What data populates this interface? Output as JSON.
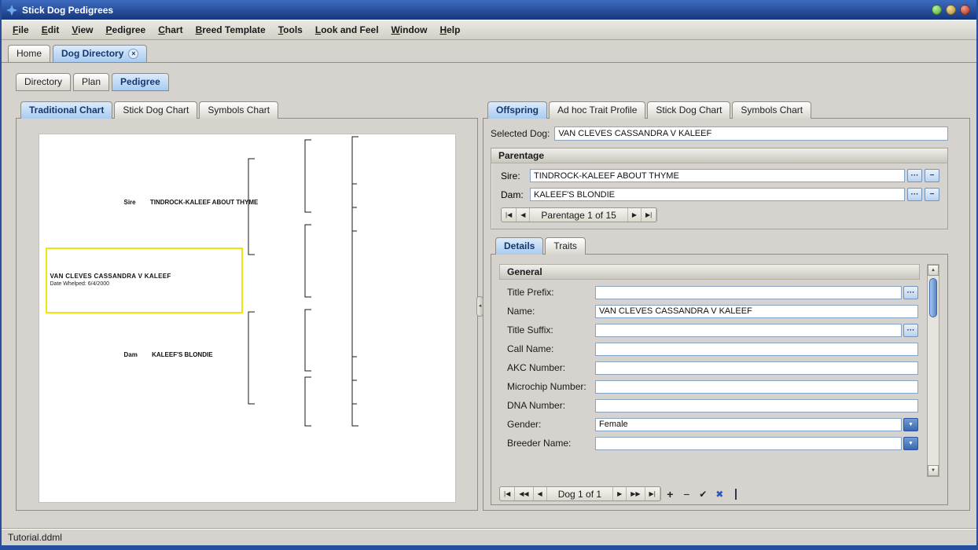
{
  "window": {
    "title": "Stick Dog Pedigrees"
  },
  "menu": {
    "items": [
      "File",
      "Edit",
      "View",
      "Pedigree",
      "Chart",
      "Breed Template",
      "Tools",
      "Look and Feel",
      "Window",
      "Help"
    ]
  },
  "document_tabs": {
    "home": "Home",
    "dog_directory": "Dog Directory"
  },
  "view_tabs": {
    "directory": "Directory",
    "plan": "Plan",
    "pedigree": "Pedigree"
  },
  "chart_panel": {
    "tabs": {
      "traditional": "Traditional Chart",
      "stick": "Stick Dog Chart",
      "symbols": "Symbols Chart"
    },
    "sire_label": "Sire",
    "sire_name": "TINDROCK-KALEEF ABOUT THYME",
    "subject_name": "VAN CLEVES CASSANDRA V KALEEF",
    "subject_whelped": "Date Whelped: 6/4/2000",
    "dam_label": "Dam",
    "dam_name": "KALEEF'S BLONDIE"
  },
  "offspring_panel": {
    "tabs": {
      "offspring": "Offspring",
      "adhoc": "Ad hoc Trait Profile",
      "stick": "Stick Dog Chart",
      "symbols": "Symbols Chart"
    },
    "selected_dog_label": "Selected Dog:",
    "selected_dog_value": "VAN CLEVES CASSANDRA V KALEEF",
    "parentage": {
      "title": "Parentage",
      "sire_label": "Sire:",
      "sire_value": "TINDROCK-KALEEF ABOUT THYME",
      "dam_label": "Dam:",
      "dam_value": "KALEEF'S BLONDIE",
      "nav_label": "Parentage 1 of 15"
    },
    "detail_tabs": {
      "details": "Details",
      "traits": "Traits"
    },
    "general": {
      "title": "General",
      "fields": [
        {
          "label": "Title Prefix:",
          "value": "",
          "control": "ellipsis"
        },
        {
          "label": "Name:",
          "value": "VAN CLEVES CASSANDRA V KALEEF",
          "control": "text"
        },
        {
          "label": "Title Suffix:",
          "value": "",
          "control": "ellipsis"
        },
        {
          "label": "Call Name:",
          "value": "",
          "control": "text"
        },
        {
          "label": "AKC Number:",
          "value": "",
          "control": "text"
        },
        {
          "label": "Microchip Number:",
          "value": "",
          "control": "text"
        },
        {
          "label": "DNA Number:",
          "value": "",
          "control": "text"
        },
        {
          "label": "Gender:",
          "value": "Female",
          "control": "dropdown"
        },
        {
          "label": "Breeder Name:",
          "value": "",
          "control": "dropdown"
        }
      ]
    },
    "record_nav_label": "Dog 1 of 1"
  },
  "status_bar": {
    "text": "Tutorial.ddml"
  },
  "icons": {
    "close_tab": "×",
    "ellipsis": "···",
    "remove": "−",
    "dropdown_arrow": "▼",
    "nav_first": "|◀",
    "nav_prev": "◀",
    "nav_next": "▶",
    "nav_last": "▶|",
    "nav_rewind": "◀◀",
    "nav_forward": "▶▶",
    "add": "+",
    "subtract": "−",
    "commit": "✔",
    "cancel": "✖",
    "scroll_up": "▲",
    "scroll_down": "▼",
    "splitter": "◂"
  },
  "colors": {
    "titlebar_blue": "#24509e",
    "selection_blue": "#a9cbf0",
    "highlight_yellow": "#f0e60a"
  }
}
